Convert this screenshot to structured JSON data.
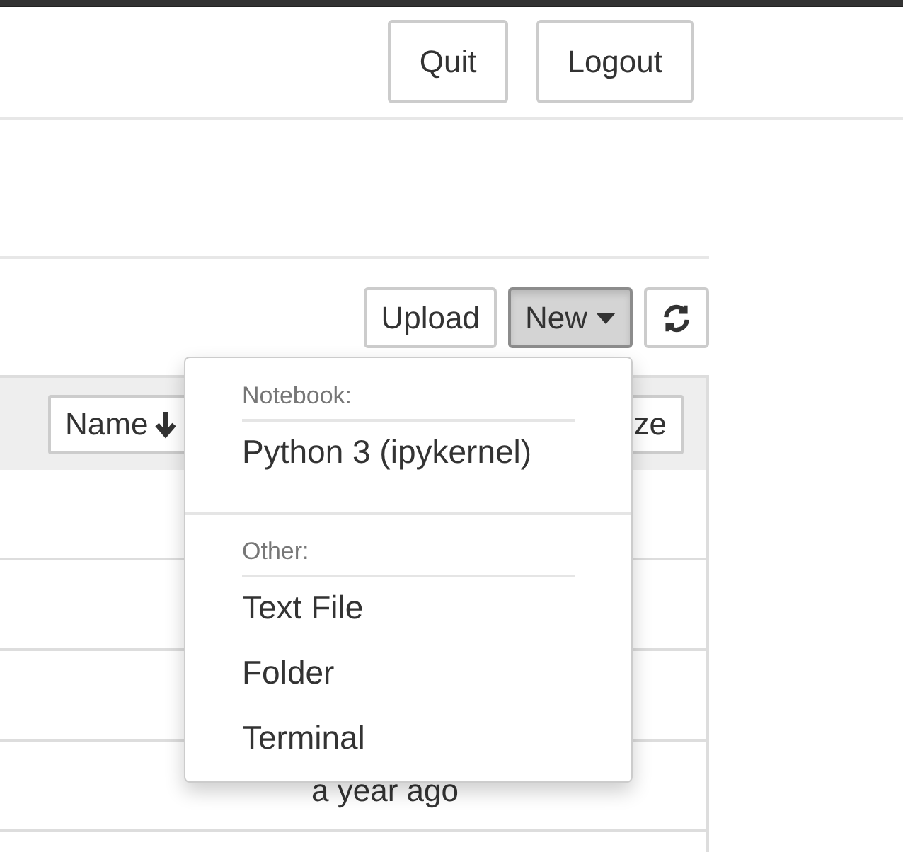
{
  "header": {
    "buttons": [
      "Quit",
      "Logout"
    ]
  },
  "toolbar": {
    "upload": "Upload",
    "new": {
      "label": "New",
      "open": true
    }
  },
  "new_menu": {
    "sections": [
      {
        "heading": "Notebook:",
        "items": [
          "Python 3 (ipykernel)"
        ]
      },
      {
        "heading": "Other:",
        "items": [
          "Text File",
          "Folder",
          "Terminal"
        ]
      }
    ]
  },
  "table": {
    "columns": [
      {
        "label": "Name",
        "sorted": true
      },
      {
        "label": "ze"
      }
    ],
    "rows": [
      {},
      {},
      {},
      {
        "column_3": "a year ago"
      }
    ]
  }
}
